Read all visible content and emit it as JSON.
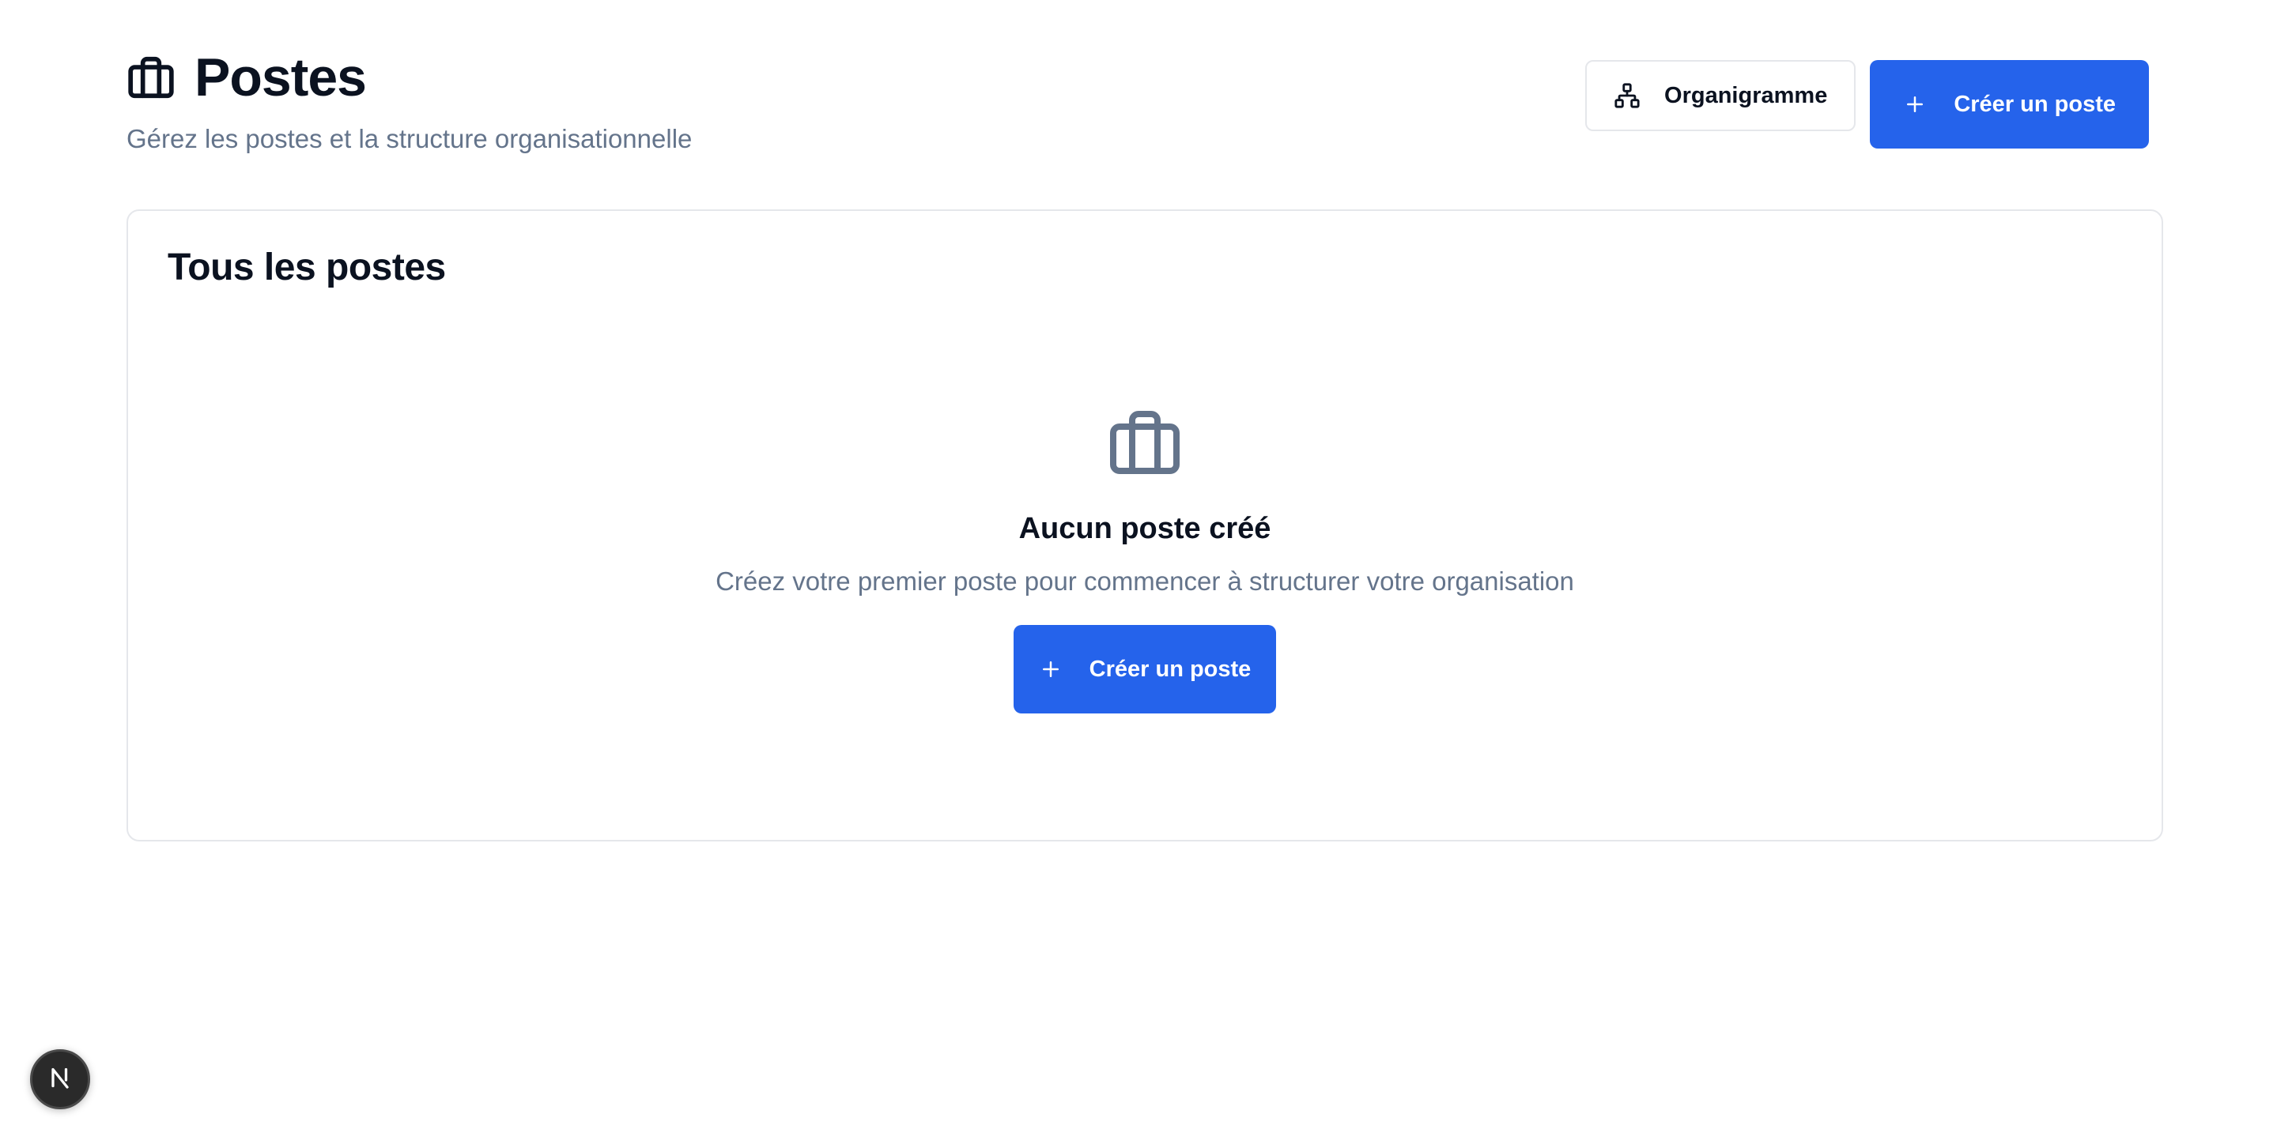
{
  "header": {
    "title": "Postes",
    "title_icon": "briefcase-icon",
    "subtitle": "Gérez les postes et la structure organisationnelle",
    "org_chart_button": {
      "label": "Organigramme",
      "icon": "org-chart-icon"
    },
    "create_button": {
      "label": "Créer un poste",
      "icon": "plus-icon"
    }
  },
  "card": {
    "title": "Tous les postes",
    "empty_state": {
      "icon": "briefcase-icon",
      "title": "Aucun poste créé",
      "description": "Créez votre premier poste pour commencer à structurer votre organisation",
      "button": {
        "label": "Créer un poste",
        "icon": "plus-icon"
      }
    }
  },
  "dev_badge": {
    "letter": "N",
    "icon": "nextjs-icon"
  },
  "colors": {
    "primary": "#2563eb",
    "muted_text": "#64748b",
    "border": "#e5e7eb",
    "icon_gray": "#64748b"
  }
}
